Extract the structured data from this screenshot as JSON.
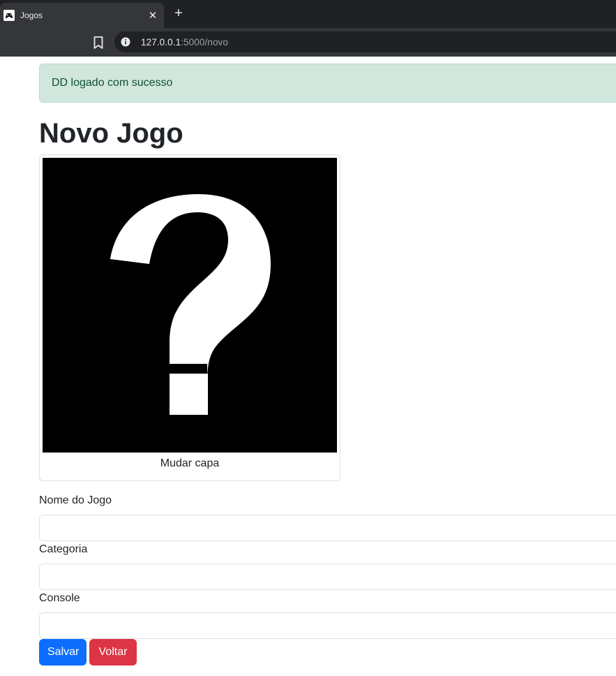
{
  "browser": {
    "tab_title": "Jogos",
    "url_host": "127.0.0.1",
    "url_path": ":5000/novo"
  },
  "alert": {
    "message": "DD logado com sucesso"
  },
  "page": {
    "title": "Novo Jogo"
  },
  "cover": {
    "caption": "Mudar capa"
  },
  "form": {
    "name_label": "Nome do Jogo",
    "name_value": "",
    "category_label": "Categoria",
    "category_value": "",
    "console_label": "Console",
    "console_value": "",
    "save_label": "Salvar",
    "back_label": "Voltar"
  },
  "colors": {
    "primary": "#0d6efd",
    "danger": "#dc3545",
    "success_bg": "#d1e7dd",
    "success_text": "#0f5132"
  }
}
